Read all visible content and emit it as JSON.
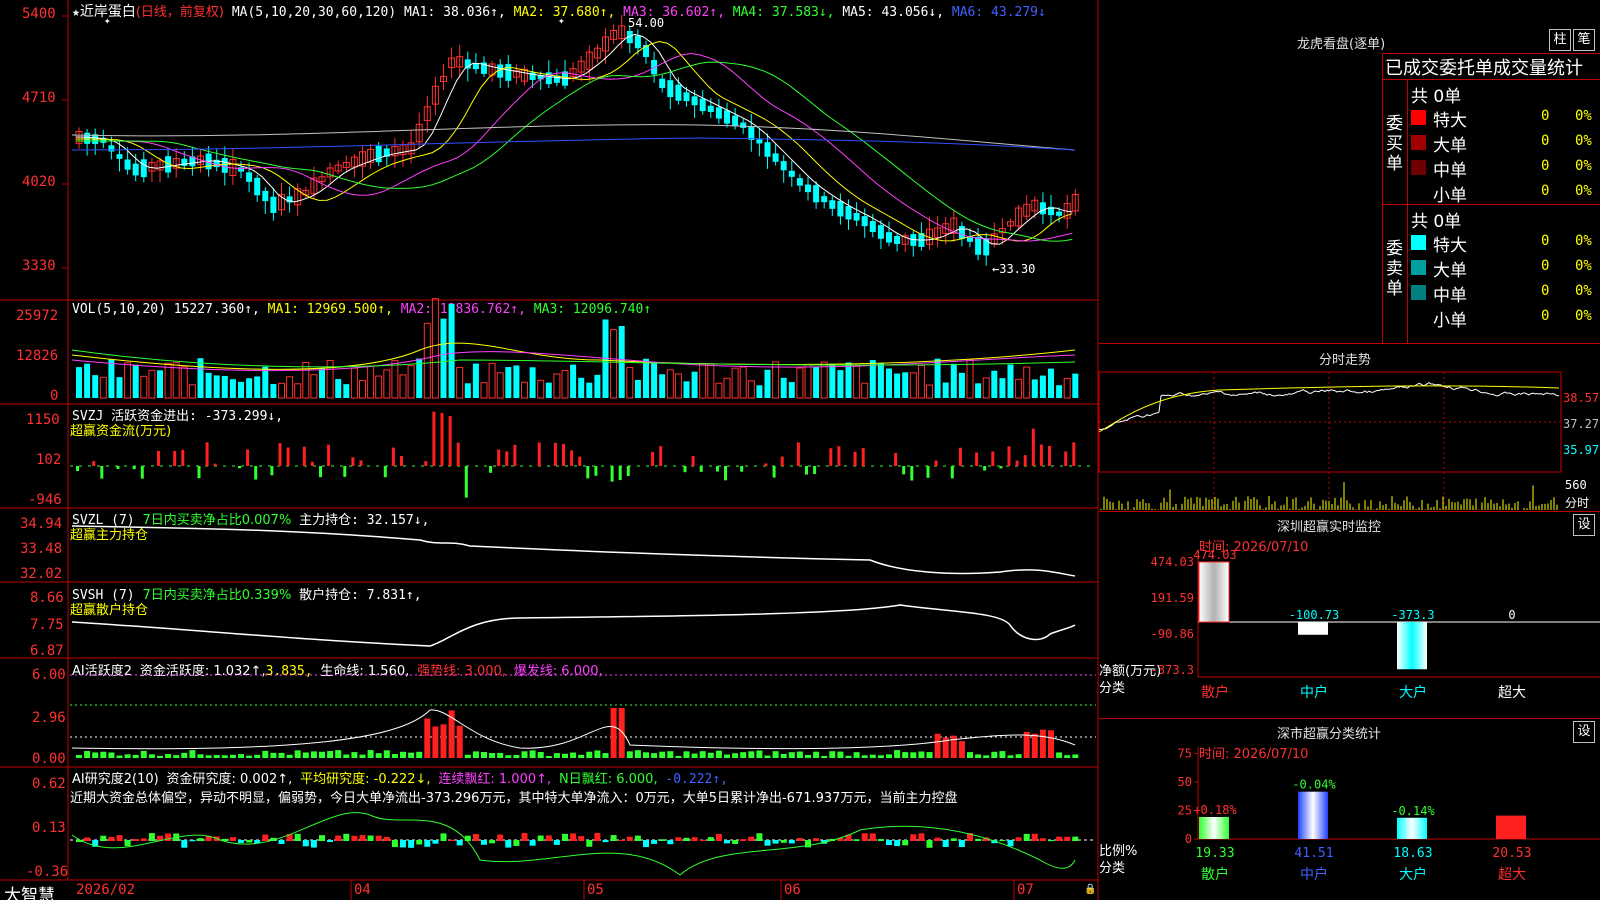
{
  "stock": {
    "name": "近岸蛋白",
    "mode": "(日线，前复权)",
    "ma_label": "MA(5,10,20,30,60,120)",
    "ma1": "MA1: 38.036↑,",
    "ma2": "MA2: 37.680↑,",
    "ma3": "MA3: 36.602↑,",
    "ma4": "MA4: 37.583↓,",
    "ma5": "MA5: 43.056↓,",
    "ma6": "MA6: 43.279↓",
    "high_mark": "54.00",
    "low_mark": "←33.30",
    "price_axis": [
      "5400",
      "4710",
      "4020",
      "3330"
    ]
  },
  "vol": {
    "label": "VOL(5,10,20)",
    "value": "15227.360↑,",
    "ma1": "MA1: 12969.500↑,",
    "ma2": "MA2: 13836.762↑,",
    "ma3": "MA3: 12096.740↑",
    "axis": [
      "25972",
      "12826",
      "0"
    ]
  },
  "svzj": {
    "label": "SVZJ  活跃资金进出: -373.299↓,",
    "sub": "超赢资金流(万元)",
    "axis": [
      "1150",
      "102",
      "-946"
    ]
  },
  "svzl": {
    "label": "SVZL (7)",
    "ratio": "7日内买卖净占比0.007%",
    "hold": "主力持仓: 32.157↓,",
    "sub": "超赢主力持仓",
    "axis": [
      "34.94",
      "33.48",
      "32.02"
    ]
  },
  "svsh": {
    "label": "SVSH (7)",
    "ratio": "7日内买卖净占比0.339%",
    "hold": "散户持仓: 7.831↑,",
    "sub": "超赢散户持仓",
    "axis": [
      "8.66",
      "7.75",
      "6.87"
    ]
  },
  "ai1": {
    "label": "AI活跃度2",
    "active": "资金活跃度: 1.032↑,",
    "v2": "3.835,",
    "life": "生命线: 1.560,",
    "strong": "强势线: 3.000,",
    "burst": "爆发线: 6.000,",
    "axis": [
      "6.00",
      "2.96",
      "0.00"
    ]
  },
  "ai2": {
    "label": "AI研究度2(10)",
    "research": "资金研究度: 0.002↑,",
    "avg": "平均研究度: -0.222↓,",
    "cont": "连续飘红: 1.000↑,",
    "nday": "N日飘红: 6.000,",
    "neg": "-0.222↑,",
    "comment": "近期大资金总体偏空，异动不明显，偏弱势，今日大单净流出-373.296万元，其中特大单净流入：0万元，大单5日累计净出-671.937万元，当前主力控盘",
    "axis": [
      "0.62",
      "0.13",
      "-0.36"
    ]
  },
  "dates": [
    "2026/02",
    "04",
    "05",
    "06",
    "07"
  ],
  "brand": "大智慧",
  "dragon": {
    "title": "龙虎看盘(逐单)",
    "btn1": "柱",
    "btn2": "笔",
    "subtitle": "已成交委托单成交量统计",
    "buy_side": "委买单",
    "sell_side": "委卖单",
    "buy_total": "共 0单",
    "sell_total": "共 0单",
    "rows": [
      {
        "name": "特大",
        "val": "0",
        "pct": "0%"
      },
      {
        "name": "大单",
        "val": "0",
        "pct": "0%"
      },
      {
        "name": "中单",
        "val": "0",
        "pct": "0%"
      },
      {
        "name": "小单",
        "val": "0",
        "pct": "0%"
      }
    ],
    "buy_colors": [
      "#ff0000",
      "#a00000",
      "#700000",
      "#000000"
    ],
    "sell_colors": [
      "#00ffff",
      "#00a0a0",
      "#008080",
      "#000000"
    ]
  },
  "intraday": {
    "title": "分时走势",
    "axis": [
      "38.57",
      "37.27",
      "35.97"
    ],
    "vol_axis": [
      "560",
      "分时"
    ]
  },
  "monitor": {
    "title": "深圳超赢实时监控",
    "btn": "设",
    "time": "时间: 2026/07/10",
    "axis": [
      "474.03",
      "191.59",
      "-90.86",
      "-373.3"
    ],
    "ylabel": "净额(万元)",
    "xlabel": "分类",
    "bars": [
      {
        "name": "散户",
        "value": 474.03,
        "label": "474.03"
      },
      {
        "name": "中户",
        "value": -100.73,
        "label": "-100.73"
      },
      {
        "name": "大户",
        "value": -373.3,
        "label": "-373.3"
      },
      {
        "name": "超大",
        "value": 0,
        "label": "0"
      }
    ]
  },
  "classify": {
    "title": "深市超赢分类统计",
    "btn": "设",
    "time": "时间: 2026/07/10",
    "axis": [
      "75",
      "50",
      "25",
      "0"
    ],
    "ylabel": "比例%",
    "xlabel": "分类",
    "bars": [
      {
        "name": "散户",
        "value": 19.33,
        "label": "19.33",
        "delta": "+0.18%"
      },
      {
        "name": "中户",
        "value": 41.51,
        "label": "41.51",
        "delta": "-0.04%"
      },
      {
        "name": "大户",
        "value": 18.63,
        "label": "18.63",
        "delta": "-0.14%"
      },
      {
        "name": "超大",
        "value": 20.53,
        "label": "20.53",
        "delta": ""
      }
    ]
  }
}
